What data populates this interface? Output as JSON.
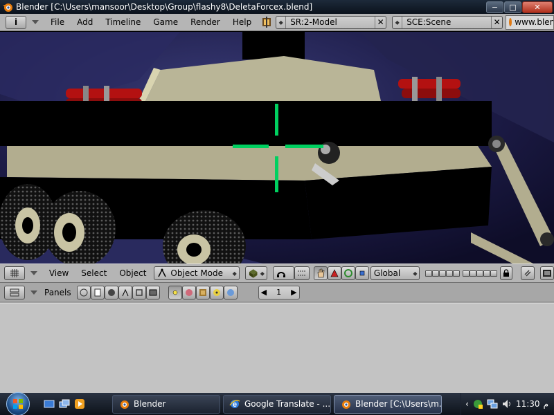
{
  "window": {
    "title": "Blender [C:\\Users\\mansoor\\Desktop\\Group\\flashy8\\DeletaForcex.blend]",
    "minimize_glyph": "−",
    "maximize_glyph": "□",
    "close_glyph": "✕"
  },
  "main_header": {
    "editor_icon": "i",
    "menus": [
      "File",
      "Add",
      "Timeline",
      "Game",
      "Render",
      "Help"
    ],
    "screen_field": "SR:2-Model",
    "scene_field": "SCE:Scene",
    "url": "www.blender.org"
  },
  "view3d_header": {
    "menus": [
      "View",
      "Select",
      "Object"
    ],
    "mode": "Object Mode",
    "orientation": "Global"
  },
  "buttons_window": {
    "panels_label": "Panels",
    "frame_number": "1"
  },
  "taskbar": {
    "tasks": [
      {
        "label": "Blender",
        "icon": "blender-icon",
        "active": false
      },
      {
        "label": "Google Translate - ...",
        "icon": "ie-icon",
        "active": false
      },
      {
        "label": "Blender [C:\\Users\\m...",
        "icon": "blender-icon",
        "active": true
      }
    ],
    "clock": "11:30",
    "clock_suffix": "م"
  },
  "colors": {
    "viewport_bg": "#17163a",
    "crosshair": "#00d060",
    "panel_gray": "#b5b5b5",
    "header_field": "#c7c7c7",
    "taskbar": "#1b2230"
  }
}
